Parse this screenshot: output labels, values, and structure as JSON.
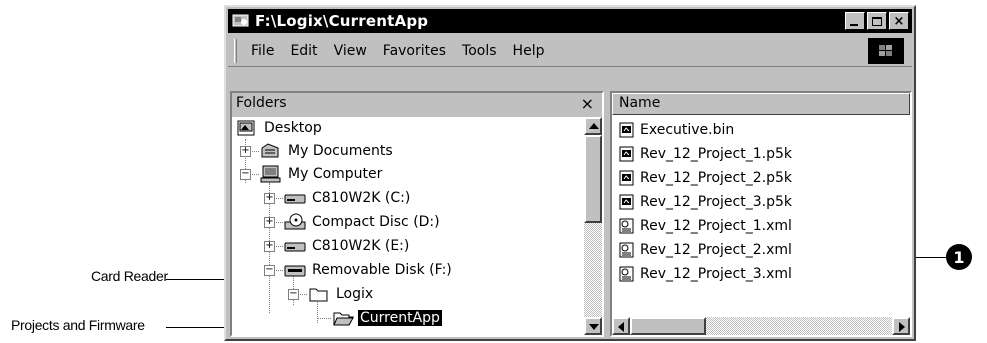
{
  "window": {
    "title": "F:\\Logix\\CurrentApp",
    "controls": [
      "_",
      "□",
      "×"
    ]
  },
  "menu": [
    "File",
    "Edit",
    "View",
    "Favorites",
    "Tools",
    "Help"
  ],
  "folders_pane": {
    "header": "Folders",
    "close": "×",
    "tree": [
      {
        "label": "Desktop",
        "icon": "desktop-icon"
      },
      {
        "label": "My Documents",
        "icon": "documents-folder-icon",
        "expander": "+"
      },
      {
        "label": "My Computer",
        "icon": "computer-icon",
        "expander": "−"
      },
      {
        "label": "C810W2K (C:)",
        "icon": "drive-icon",
        "expander": "+"
      },
      {
        "label": "Compact Disc (D:)",
        "icon": "cd-icon",
        "expander": "+"
      },
      {
        "label": "C810W2K (E:)",
        "icon": "drive-icon",
        "expander": "+"
      },
      {
        "label": "Removable Disk (F:)",
        "icon": "removable-disk-icon",
        "expander": "−"
      },
      {
        "label": "Logix",
        "icon": "folder-icon",
        "expander": "−"
      },
      {
        "label": "CurrentApp",
        "icon": "open-folder-icon",
        "selected": true
      }
    ]
  },
  "files_pane": {
    "column": "Name",
    "files": [
      {
        "name": "Executive.bin",
        "icon": "binary-file-icon"
      },
      {
        "name": "Rev_12_Project_1.p5k",
        "icon": "binary-file-icon"
      },
      {
        "name": "Rev_12_Project_2.p5k",
        "icon": "binary-file-icon"
      },
      {
        "name": "Rev_12_Project_3.p5k",
        "icon": "binary-file-icon"
      },
      {
        "name": "Rev_12_Project_1.xml",
        "icon": "xml-file-icon"
      },
      {
        "name": "Rev_12_Project_2.xml",
        "icon": "xml-file-icon"
      },
      {
        "name": "Rev_12_Project_3.xml",
        "icon": "xml-file-icon"
      }
    ]
  },
  "callouts": {
    "card_reader": "Card Reader",
    "projects": "Projects and Firmware",
    "badge": "1"
  }
}
